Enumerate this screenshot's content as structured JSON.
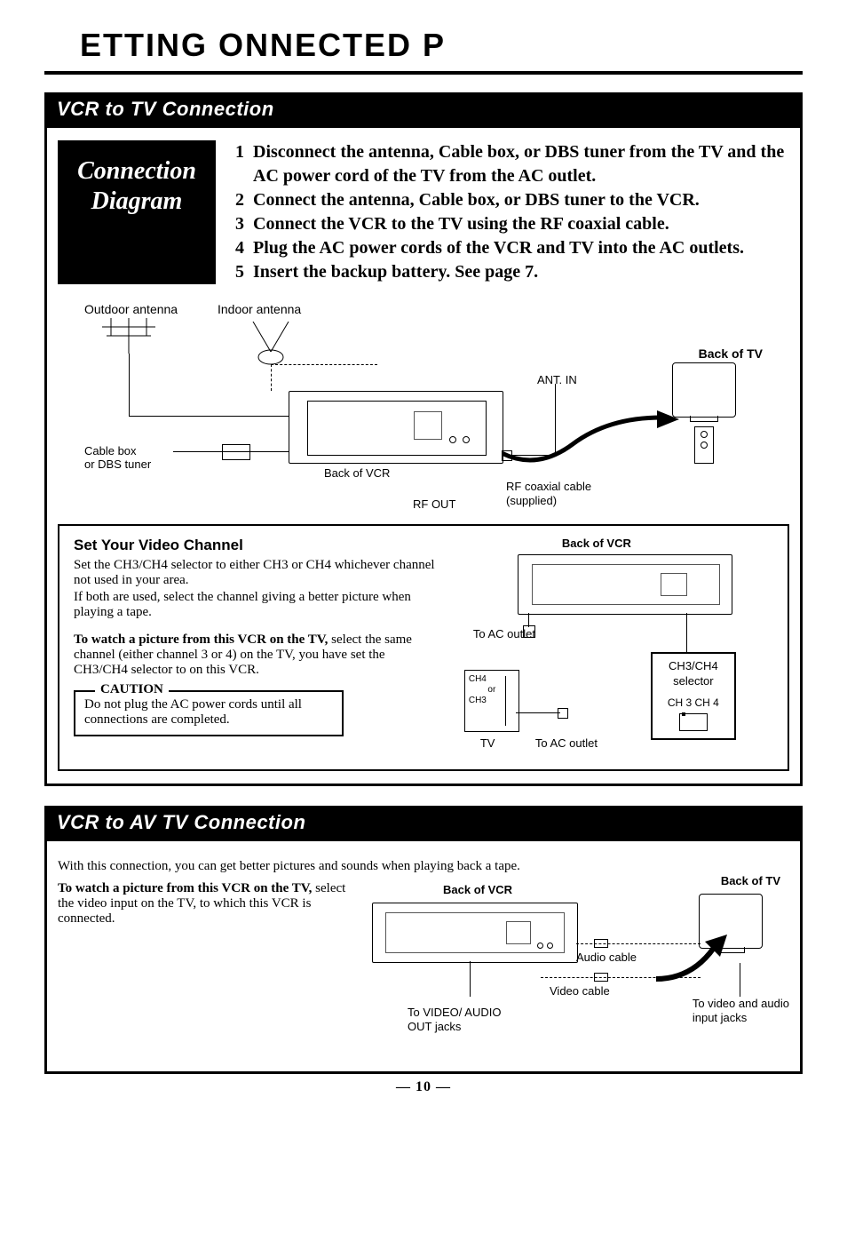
{
  "page": {
    "title": "ETTING    ONNECTED     P",
    "number": "— 10 —"
  },
  "section1": {
    "bar": "VCR to TV Connection",
    "diagram_box_line1": "Connection",
    "diagram_box_line2": "Diagram",
    "steps": [
      {
        "num": "1",
        "text": "Disconnect the antenna, Cable box, or DBS tuner from the TV and the AC power cord of the TV from the AC outlet."
      },
      {
        "num": "2",
        "text": "Connect the antenna, Cable box, or DBS tuner to the VCR."
      },
      {
        "num": "3",
        "text": "Connect the VCR to the TV using the RF coaxial cable."
      },
      {
        "num": "4",
        "text": "Plug the AC power cords of the VCR and TV into the AC out­lets."
      },
      {
        "num": "5",
        "text": "Insert the backup battery. See page 7."
      }
    ],
    "diagram_labels": {
      "outdoor_antenna": "Outdoor antenna",
      "indoor_antenna": "Indoor antenna",
      "back_of_tv": "Back of TV",
      "ant_in": "ANT. IN",
      "cable_box": "Cable box\nor DBS tuner",
      "back_of_vcr": "Back of VCR",
      "rf_out": "RF OUT",
      "rf_coax": "RF coaxial cable\n(supplied)"
    },
    "set_channel": {
      "heading": "Set Your Video Channel",
      "p1": "Set the CH3/CH4 selector to either CH3 or CH4 whichever channel not used in your area.",
      "p2": "If both are used, select the channel giving a better picture when playing a tape.",
      "p3_lead": "To watch a picture from this VCR on the TV,",
      "p3_rest": " select the same channel (either channel 3 or 4) on the TV, you have set the CH3/CH4 selector to on this VCR.",
      "caution_title": "CAUTION",
      "caution_body": "Do not plug the AC power cords until all connections are completed.",
      "right_labels": {
        "back_of_vcr": "Back of VCR",
        "to_ac_outlet_top": "To AC outlet",
        "ch34_selector": "CH3/CH4\nselector",
        "ch3_ch4": "CH 3  CH 4",
        "ch4": "CH4",
        "or": "or",
        "ch3": "CH3",
        "tv": "TV",
        "to_ac_outlet_bottom": "To AC outlet"
      }
    }
  },
  "section2": {
    "bar": "VCR to AV TV Connection",
    "intro": "With this connection, you can get better pictures and sounds when playing back a tape.",
    "left_lead": "To watch a picture from this VCR on the TV,",
    "left_rest": " select the video input on the TV, to which this VCR is connected.",
    "labels": {
      "back_of_tv": "Back of TV",
      "back_of_vcr": "Back of VCR",
      "audio_cable": "Audio cable",
      "video_cable": "Video cable",
      "to_out_jacks": "To VIDEO/ AUDIO\nOUT jacks",
      "to_in_jacks": "To video and audio\ninput jacks"
    }
  }
}
